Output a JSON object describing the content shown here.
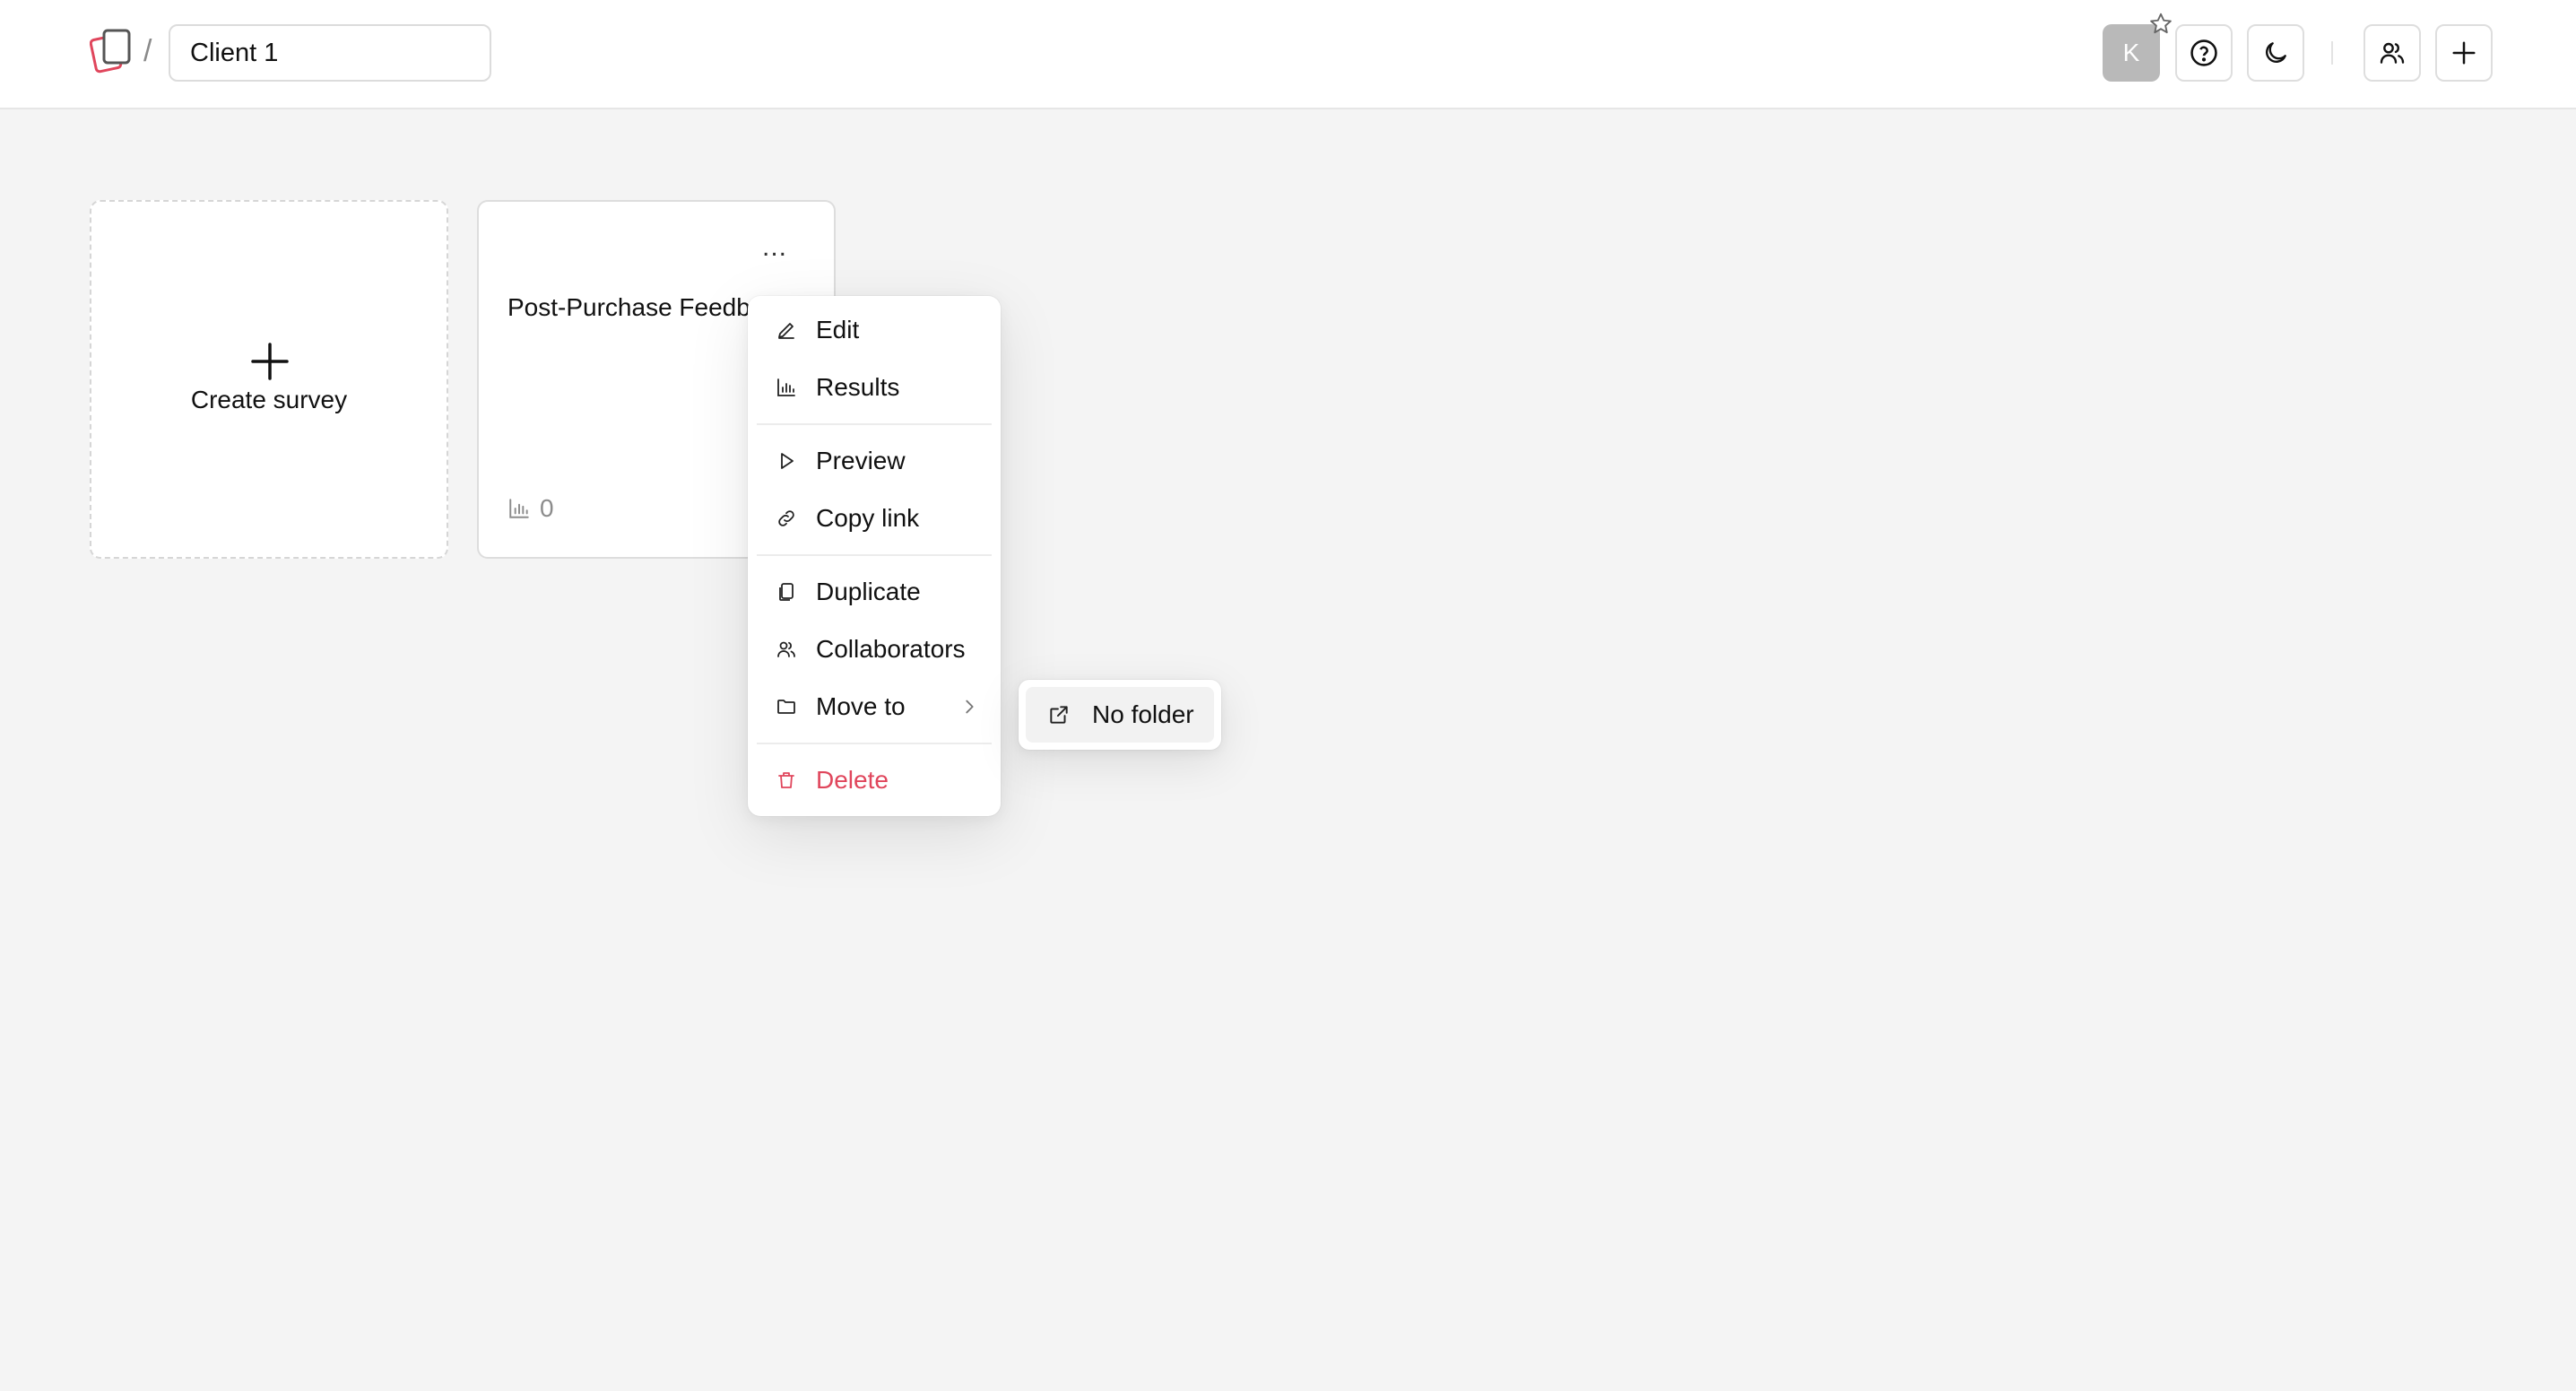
{
  "header": {
    "folder_name": "Client 1",
    "breadcrumb_separator": "/",
    "avatar_initial": "K",
    "icons": [
      "logo-icon",
      "star-icon",
      "help-icon",
      "moon-icon",
      "collaborators-icon",
      "plus-icon"
    ],
    "brand_color": "#e0465c"
  },
  "cards": {
    "create_label": "Create survey",
    "survey": {
      "title": "Post-Purchase Feedback",
      "more_label": "...",
      "response_count": "0"
    }
  },
  "menu": {
    "items": [
      {
        "label": "Edit",
        "icon": "pencil-icon"
      },
      {
        "label": "Results",
        "icon": "bar-chart-icon"
      },
      {
        "label": "Preview",
        "icon": "play-icon"
      },
      {
        "label": "Copy link",
        "icon": "link-icon"
      },
      {
        "label": "Duplicate",
        "icon": "copy-icon"
      },
      {
        "label": "Collaborators",
        "icon": "users-icon"
      },
      {
        "label": "Move to",
        "icon": "folder-icon"
      },
      {
        "label": "Delete",
        "icon": "trash-icon",
        "color": "#e0465c"
      }
    ],
    "submenu": {
      "items": [
        {
          "label": "No folder",
          "icon": "external-icon"
        }
      ]
    }
  }
}
